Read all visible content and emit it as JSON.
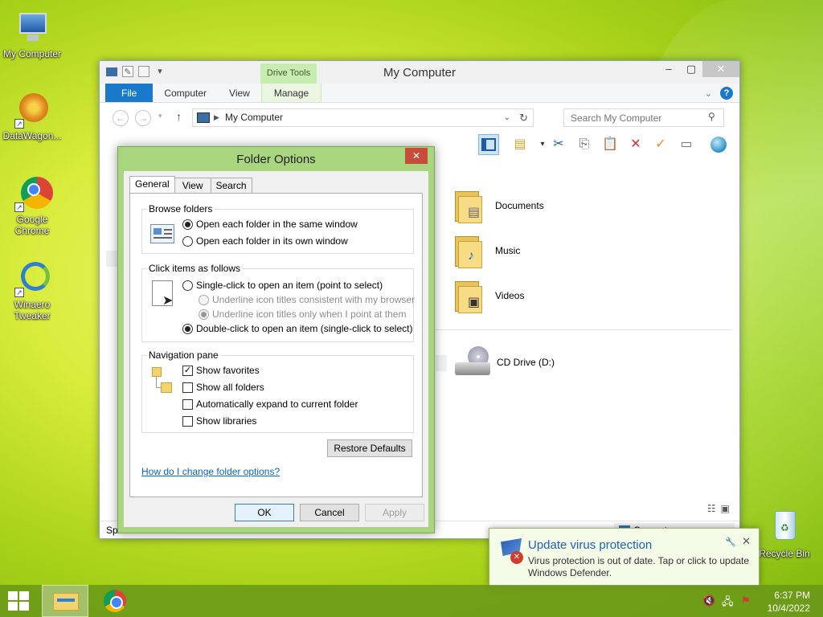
{
  "desktop": {
    "icons": [
      {
        "label": "My Computer"
      },
      {
        "label": "DataWagon..."
      },
      {
        "label": "Google Chrome"
      },
      {
        "label": "Winaero Tweaker"
      },
      {
        "label": "Recycle Bin"
      }
    ]
  },
  "explorer": {
    "title": "My Computer",
    "contextual_tab_group": "Drive Tools",
    "tabs": [
      "File",
      "Computer",
      "View",
      "Manage"
    ],
    "address": "My Computer",
    "search_placeholder": "Search My Computer",
    "items": [
      "Documents",
      "Music",
      "Videos"
    ],
    "drive": "CD Drive (D:)",
    "status_left": "Sp",
    "status_right": "Computer"
  },
  "dialog": {
    "title": "Folder Options",
    "tabs": [
      "General",
      "View",
      "Search"
    ],
    "browse_folders": {
      "title": "Browse folders",
      "same_window": "Open each folder in the same window",
      "own_window": "Open each folder in its own window"
    },
    "click_items": {
      "title": "Click items as follows",
      "single_click": "Single-click to open an item (point to select)",
      "underline_consistent": "Underline icon titles consistent with my browser",
      "underline_point": "Underline icon titles only when I point at them",
      "double_click": "Double-click to open an item (single-click to select)"
    },
    "navigation_pane": {
      "title": "Navigation pane",
      "show_favorites": "Show favorites",
      "show_all_folders": "Show all folders",
      "auto_expand": "Automatically expand to current folder",
      "show_libraries": "Show libraries"
    },
    "restore_defaults": "Restore Defaults",
    "help_link": "How do I change folder options?",
    "ok": "OK",
    "cancel": "Cancel",
    "apply": "Apply"
  },
  "notification": {
    "title": "Update virus protection",
    "body": "Virus protection is out of date. Tap or click to update Windows Defender."
  },
  "taskbar": {
    "time": "6:37 PM",
    "date": "10/4/2022"
  }
}
